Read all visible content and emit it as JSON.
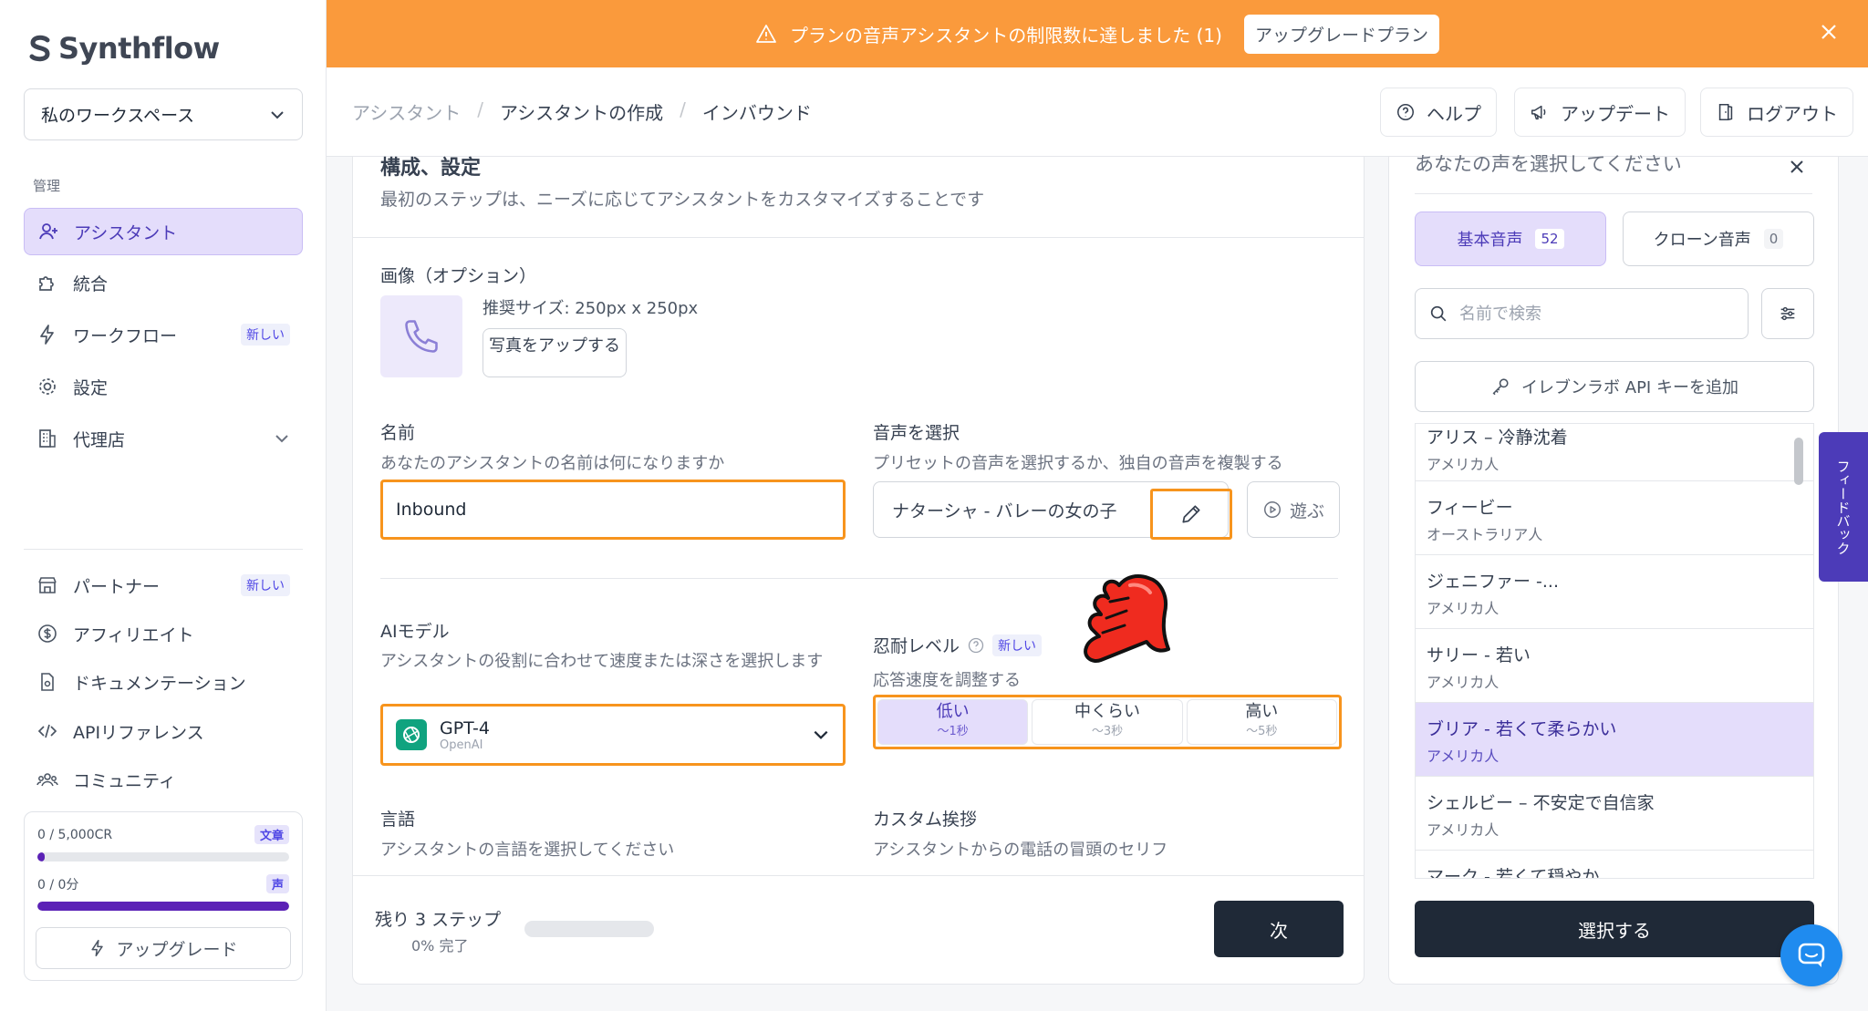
{
  "app": {
    "logo_text": "Synthflow"
  },
  "colors": {
    "accent": "#4c3bb8",
    "banner": "#fa9a3c",
    "highlight": "#f7941d",
    "primary_dark": "#1f2937"
  },
  "sidebar": {
    "workspace": "私のワークスペース",
    "section_label": "管理",
    "items": [
      {
        "label": "アシスタント",
        "icon": "user-plus-icon",
        "active": true
      },
      {
        "label": "統合",
        "icon": "puzzle-icon"
      },
      {
        "label": "ワークフロー",
        "icon": "lightning-icon",
        "badge": "新しい"
      },
      {
        "label": "設定",
        "icon": "gear-icon"
      },
      {
        "label": "代理店",
        "icon": "building-icon"
      }
    ],
    "bottom_items": [
      {
        "label": "パートナー",
        "icon": "storefront-icon",
        "badge": "新しい"
      },
      {
        "label": "アフィリエイト",
        "icon": "dollar-icon"
      },
      {
        "label": "ドキュメンテーション",
        "icon": "document-icon"
      },
      {
        "label": "APIリファレンス",
        "icon": "code-icon"
      },
      {
        "label": "コミュニティ",
        "icon": "community-icon"
      }
    ],
    "usage": {
      "credits_text": "0 / 5,000CR",
      "credits_tag": "文章",
      "credits_fraction": 0.03,
      "minutes_text": "0 / 0分",
      "minutes_tag": "声",
      "minutes_fraction": 1.0,
      "upgrade_label": "アップグレード"
    }
  },
  "banner": {
    "message": "プランの音声アシスタントの制限数に達しました (1)",
    "button": "アップグレードプラン"
  },
  "header": {
    "breadcrumbs": [
      "アシスタント",
      "アシスタントの作成",
      "インバウンド"
    ],
    "help": "ヘルプ",
    "updates": "アップデート",
    "logout": "ログアウト"
  },
  "form": {
    "section_title": "構成、設定",
    "section_subtitle": "最初のステップは、ニーズに応じてアシスタントをカスタマイズすることです",
    "image_label": "画像（オプション）",
    "image_hint": "推奨サイズ: 250px x 250px",
    "upload_button": "写真をアップする",
    "name_label": "名前",
    "name_help": "あなたのアシスタントの名前は何になりますか",
    "name_value": "Inbound",
    "voice_label": "音声を選択",
    "voice_help": "プリセットの音声を選択するか、独自の音声を複製する",
    "voice_value": "ナターシャ - バレーの女の子",
    "play_label": "遊ぶ",
    "model_label": "AIモデル",
    "model_help": "アシスタントの役割に合わせて速度または深さを選択します",
    "model_name": "GPT-4",
    "model_provider": "OpenAI",
    "patience_label": "忍耐レベル",
    "patience_badge": "新しい",
    "patience_help": "応答速度を調整する",
    "patience_options": [
      {
        "label": "低い",
        "sub": "〜1秒"
      },
      {
        "label": "中くらい",
        "sub": "〜3秒"
      },
      {
        "label": "高い",
        "sub": "〜5秒"
      }
    ],
    "language_label": "言語",
    "language_help": "アシスタントの言語を選択してください",
    "greeting_label": "カスタム挨拶",
    "greeting_help": "アシスタントからの電話の冒頭のセリフ",
    "steps_remaining": "残り 3 ステップ",
    "steps_percent": "0% 完了",
    "next_button": "次"
  },
  "voice_panel": {
    "title": "あなたの声を選択してください",
    "tab_basic": "基本音声",
    "tab_basic_count": "52",
    "tab_clone": "クローン音声",
    "tab_clone_count": "0",
    "search_placeholder": "名前で検索",
    "elevenlabs_button": "イレブンラボ API キーを追加",
    "voices": [
      {
        "name": "アリス – 冷静沈着",
        "accent": "アメリカ人"
      },
      {
        "name": "フィービー",
        "accent": "オーストラリア人"
      },
      {
        "name": "ジェニファー -...",
        "accent": "アメリカ人"
      },
      {
        "name": "サリー - 若い",
        "accent": "アメリカ人"
      },
      {
        "name": "ブリア - 若くて柔らかい",
        "accent": "アメリカ人",
        "selected": true
      },
      {
        "name": "シェルビー – 不安定で自信家",
        "accent": "アメリカ人"
      },
      {
        "name": "マーク - 若くて穏やか",
        "accent": ""
      }
    ],
    "select_button": "選択する"
  },
  "feedback_tab": "フィードバック"
}
